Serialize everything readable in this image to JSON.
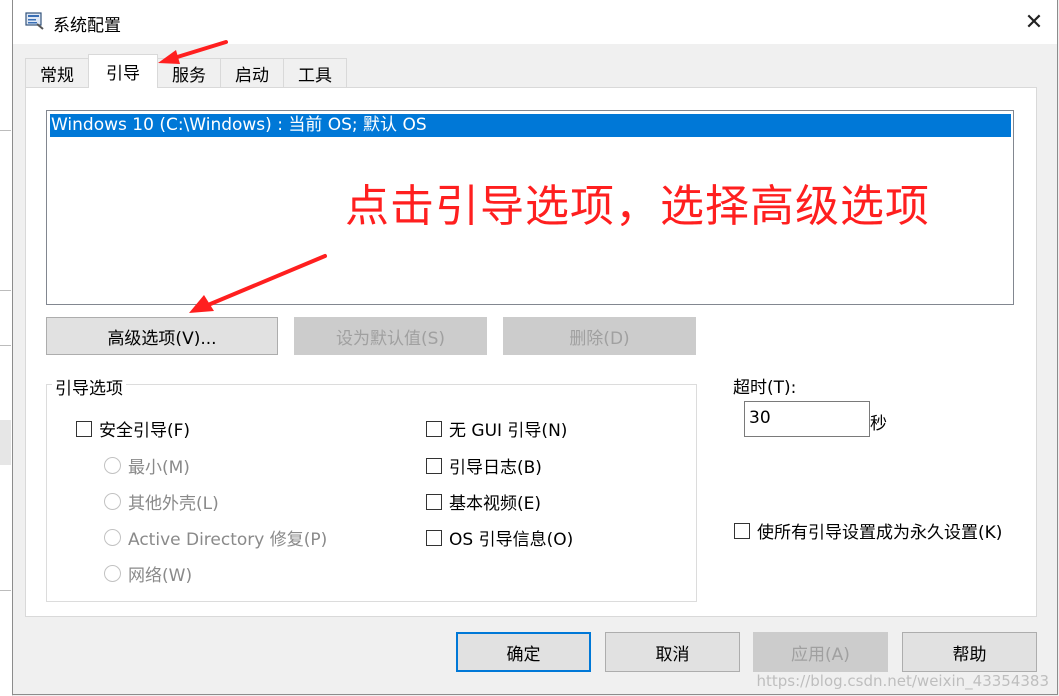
{
  "window": {
    "title": "系统配置",
    "close_glyph": "✕"
  },
  "tabs": [
    {
      "label": "常规"
    },
    {
      "label": "引导",
      "active": true
    },
    {
      "label": "服务"
    },
    {
      "label": "启动"
    },
    {
      "label": "工具"
    }
  ],
  "boot_list": {
    "items": [
      "Windows 10 (C:\\Windows) : 当前 OS; 默认 OS"
    ]
  },
  "annotation": {
    "text": "点击引导选项，选择高级选项",
    "color": "#ff1f1f"
  },
  "actions": {
    "advanced": "高级选项(V)...",
    "set_default": "设为默认值(S)",
    "delete": "删除(D)"
  },
  "boot_options": {
    "group_label": "引导选项",
    "safe_boot": "安全引导(F)",
    "minimal": "最小(M)",
    "alternate_shell": "其他外壳(L)",
    "ad_repair": "Active Directory 修复(P)",
    "network": "网络(W)",
    "no_gui": "无 GUI 引导(N)",
    "boot_log": "引导日志(B)",
    "base_video": "基本视频(E)",
    "os_info": "OS 引导信息(O)"
  },
  "timeout": {
    "label": "超时(T):",
    "value": "30",
    "unit": "秒"
  },
  "permanent": "使所有引导设置成为永久设置(K)",
  "footer": {
    "ok": "确定",
    "cancel": "取消",
    "apply": "应用(A)",
    "help": "帮助"
  },
  "watermark": "https://blog.csdn.net/weixin_43354383",
  "colors": {
    "selection": "#0078d7",
    "arrow": "#ff1f1f",
    "default_button_border": "#0078d7"
  }
}
